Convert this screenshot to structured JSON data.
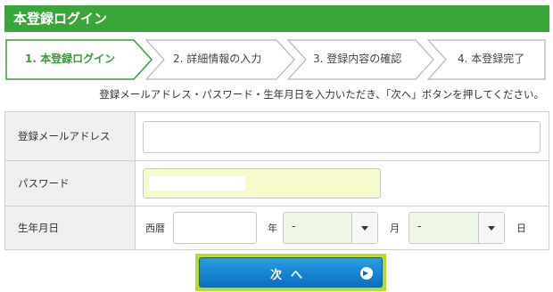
{
  "header": {
    "title": "本登録ログイン"
  },
  "steps": [
    {
      "label": "1. 本登録ログイン",
      "active": true
    },
    {
      "label": "2. 詳細情報の入力",
      "active": false
    },
    {
      "label": "3. 登録内容の確認",
      "active": false
    },
    {
      "label": "4. 本登録完了",
      "active": false
    }
  ],
  "instruction": "登録メールアドレス・パスワード・生年月日を入力いただき、「次へ」ボタンを押してください。",
  "form": {
    "email": {
      "label": "登録メールアドレス",
      "value": ""
    },
    "password": {
      "label": "パスワード"
    },
    "birth": {
      "label": "生年月日",
      "era": "西暦",
      "year_value": "",
      "year_unit": "年",
      "month_value": "-",
      "month_unit": "月",
      "day_value": "-",
      "day_unit": "日"
    }
  },
  "next_button": {
    "label": "次へ",
    "icon": "arrow-circle-right-icon"
  },
  "colors": {
    "header_green": "#3aa63a",
    "active_step": "#3a9a3a",
    "password_bg": "#f7fbcb",
    "select_bg": "#eef6e6",
    "button_blue": "#0a6fc2",
    "highlight": "#b5dc2a"
  }
}
